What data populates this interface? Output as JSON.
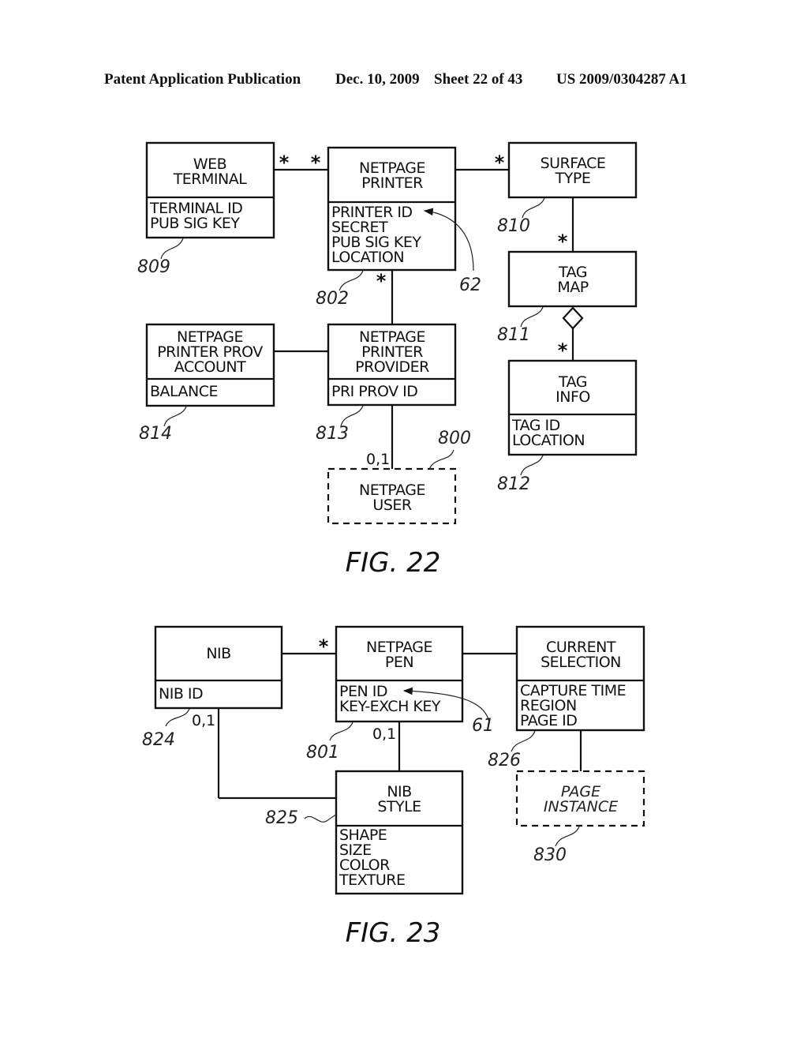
{
  "header": {
    "publication": "Patent Application Publication",
    "date": "Dec. 10, 2009",
    "sheet": "Sheet 22 of 43",
    "number": "US 2009/0304287 A1"
  },
  "fig22": {
    "caption": "FIG. 22",
    "web_terminal": {
      "title": [
        "WEB",
        "TERMINAL"
      ],
      "attrs": [
        "TERMINAL ID",
        "PUB SIG KEY"
      ],
      "ref": "809"
    },
    "netpage_printer": {
      "title": [
        "NETPAGE",
        "PRINTER"
      ],
      "attrs": [
        "PRINTER ID",
        "SECRET",
        "PUB SIG KEY",
        "LOCATION"
      ],
      "ref": "802"
    },
    "surface_type": {
      "title": [
        "SURFACE",
        "TYPE"
      ],
      "ref": "810"
    },
    "tag_map": {
      "title": [
        "TAG",
        "MAP"
      ],
      "ref": "811"
    },
    "tag_info": {
      "title": [
        "TAG",
        "INFO"
      ],
      "attrs": [
        "TAG ID",
        "LOCATION"
      ],
      "ref": "812"
    },
    "printer_prov_account": {
      "title": [
        "NETPAGE",
        "PRINTER PROV",
        "ACCOUNT"
      ],
      "attrs": [
        "BALANCE"
      ],
      "ref": "814"
    },
    "printer_provider": {
      "title": [
        "NETPAGE",
        "PRINTER",
        "PROVIDER"
      ],
      "attrs": [
        "PRI PROV ID"
      ],
      "ref": "813"
    },
    "netpage_user": {
      "title": [
        "NETPAGE",
        "USER"
      ],
      "ref": "800"
    },
    "arrow_ref": "62",
    "mult_many": "*",
    "mult_zero_one": "0,1"
  },
  "fig23": {
    "caption": "FIG. 23",
    "nib": {
      "title": [
        "NIB"
      ],
      "attrs": [
        "NIB ID"
      ],
      "ref": "824"
    },
    "netpage_pen": {
      "title": [
        "NETPAGE",
        "PEN"
      ],
      "attrs": [
        "PEN ID",
        "KEY-EXCH KEY"
      ],
      "ref": "801"
    },
    "current_selection": {
      "title": [
        "CURRENT",
        "SELECTION"
      ],
      "attrs": [
        "CAPTURE TIME",
        "REGION",
        "PAGE ID"
      ],
      "ref": "826"
    },
    "nib_style": {
      "title": [
        "NIB",
        "STYLE"
      ],
      "attrs": [
        "SHAPE",
        "SIZE",
        "COLOR",
        "TEXTURE"
      ],
      "ref": "825"
    },
    "page_instance": {
      "title": [
        "PAGE",
        "INSTANCE"
      ],
      "ref": "830"
    },
    "arrow_ref": "61",
    "mult_many": "*",
    "mult_zero_one": "0,1"
  }
}
